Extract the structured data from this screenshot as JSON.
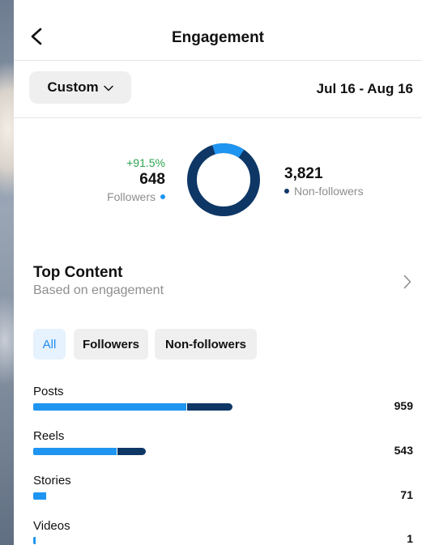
{
  "header": {
    "title": "Engagement"
  },
  "filter": {
    "range_button": "Custom",
    "date_range": "Jul 16 - Aug 16"
  },
  "audience": {
    "followers": {
      "change": "+91.5%",
      "value": "648",
      "label": "Followers",
      "color": "#1e95f0"
    },
    "non_followers": {
      "value": "3,821",
      "label": "Non-followers",
      "color": "#0e3766"
    },
    "followers_share": 0.145
  },
  "top_content": {
    "title": "Top Content",
    "subtitle": "Based on engagement"
  },
  "tabs": [
    {
      "label": "All",
      "active": true
    },
    {
      "label": "Followers",
      "active": false
    },
    {
      "label": "Non-followers",
      "active": false
    }
  ],
  "content_types": [
    {
      "label": "Posts",
      "value": "959",
      "followers_share": 0.77
    },
    {
      "label": "Reels",
      "value": "543",
      "followers_share": 0.74
    },
    {
      "label": "Stories",
      "value": "71",
      "followers_share": 0.9
    },
    {
      "label": "Videos",
      "value": "1",
      "followers_share": 1
    }
  ],
  "colors": {
    "accent": "#1e95f0",
    "dark": "#0e3766",
    "positive": "#2ea44f"
  }
}
